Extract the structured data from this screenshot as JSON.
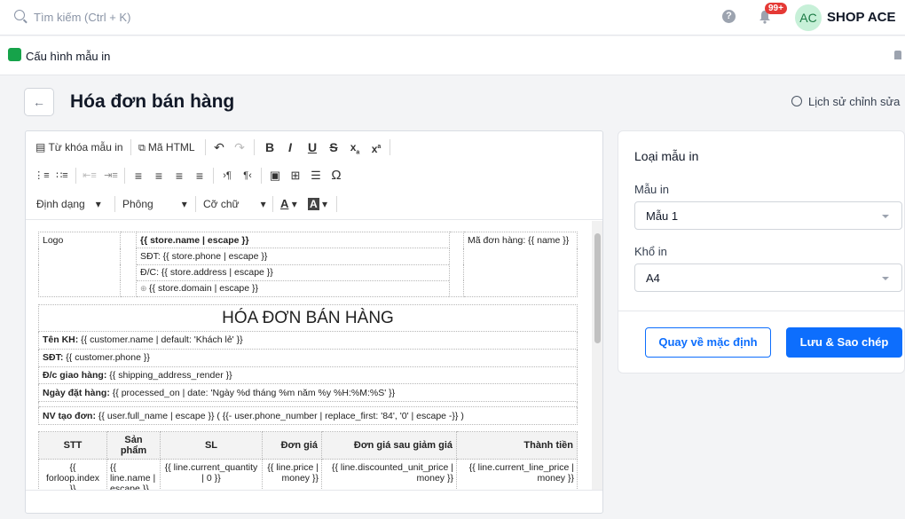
{
  "topbar": {
    "search_placeholder": "Tìm kiếm (Ctrl + K)",
    "help_glyph": "?",
    "notifications_count": "99+",
    "avatar_initials": "AC",
    "shop_name": "SHOP ACE"
  },
  "subbar": {
    "title": "Cấu hình mẫu in"
  },
  "page": {
    "title": "Hóa đơn bán hàng",
    "history_label": "Lịch sử chỉnh sửa",
    "back_glyph": "←"
  },
  "toolbar": {
    "keywords_label": "Từ khóa mẫu in",
    "html_label": "Mã HTML",
    "format_label": "Định dạng",
    "font_label": "Phông",
    "size_label": "Cỡ chữ",
    "omega": "Ω",
    "bold": "B",
    "italic": "I",
    "underline": "U",
    "strike": "S",
    "undo": "↶",
    "redo": "↷"
  },
  "template": {
    "logo_alt": "Logo",
    "store_name": "{{ store.name | escape }}",
    "store_phone": "SĐT: {{ store.phone | escape }}",
    "store_address": "Đ/C: {{ store.address | escape }}",
    "store_domain": "{{ store.domain | escape }}",
    "order_code": "Mã đơn hàng: {{ name }}",
    "invoice_title": "HÓA ĐƠN BÁN HÀNG",
    "customer_label": "Tên KH:",
    "customer_value": "{{ customer.name | default: 'Khách lẻ' }}",
    "phone_label": "SĐT:",
    "phone_value": "{{ customer.phone }}",
    "address_label": "Đ/c giao hàng:",
    "address_value": "{{ shipping_address_render }}",
    "date_label": "Ngày đặt hàng:",
    "date_value": "{{ processed_on | date: 'Ngày %d tháng %m năm %y %H:%M:%S' }}",
    "staff_label": "NV tạo đơn:",
    "staff_value": "{{ user.full_name | escape }} ( {{- user.phone_number | replace_first: '84', '0' | escape -}} )",
    "items_columns": [
      "STT",
      "Sản phẩm",
      "SL",
      "Đơn giá",
      "Đơn giá sau giảm giá",
      "Thành tiền"
    ],
    "items_row": [
      "{{ forloop.index }}",
      "{{ line.name | escape }}",
      "{{ line.current_quantity | 0 }}",
      "{{ line.price | money }}",
      "{{ line.discounted_unit_price | money }}",
      "{{ line.current_line_price | money }}"
    ]
  },
  "panel": {
    "title": "Loại mẫu in",
    "template_label": "Mẫu in",
    "template_value": "Mẫu 1",
    "paper_label": "Khổ in",
    "paper_value": "A4",
    "reset_button": "Quay về mặc định",
    "save_button": "Lưu & Sao chép"
  },
  "colors": {
    "primary": "#0d6efd",
    "badge": "#e53935",
    "avatar_bg": "#c7f0d8"
  }
}
